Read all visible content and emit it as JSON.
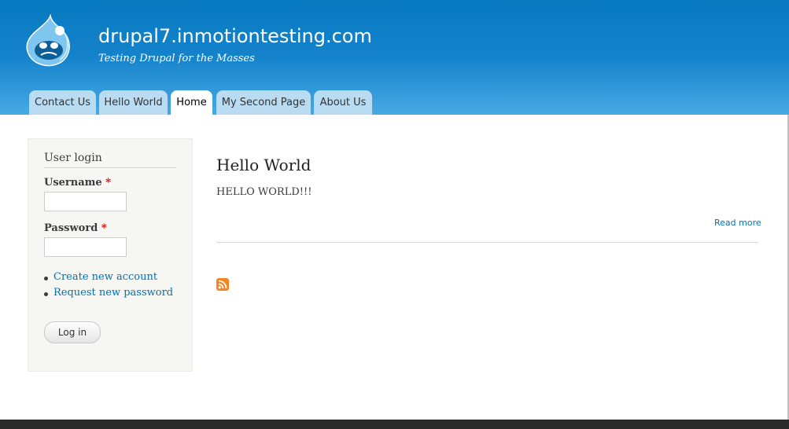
{
  "site": {
    "name": "drupal7.inmotiontesting.com",
    "slogan": "Testing Drupal for the Masses"
  },
  "menu": {
    "tabs": [
      {
        "label": "Contact Us"
      },
      {
        "label": "Hello World"
      },
      {
        "label": "Home",
        "active": true
      },
      {
        "label": "My Second Page"
      },
      {
        "label": "About Us"
      }
    ]
  },
  "login": {
    "title": "User login",
    "username_label": "Username",
    "password_label": "Password",
    "required_mark": "*",
    "username_value": "",
    "password_value": "",
    "links": [
      {
        "label": "Create new account"
      },
      {
        "label": "Request new password"
      }
    ],
    "submit_label": "Log in"
  },
  "node": {
    "title": "Hello World",
    "body": "HELLO WORLD!!!",
    "read_more": "Read more"
  },
  "icons": {
    "logo": "drupal-drop-logo-icon",
    "feed": "rss-feed-icon"
  },
  "colors": {
    "header_top": "#0779bf",
    "header_bottom": "#48a9e4",
    "tab_bg": "#b9dcf2",
    "link": "#0071b3",
    "required": "#e00000",
    "sidebar_bg": "#f6f6f2",
    "footer": "#292929",
    "feed": "#f78422"
  }
}
